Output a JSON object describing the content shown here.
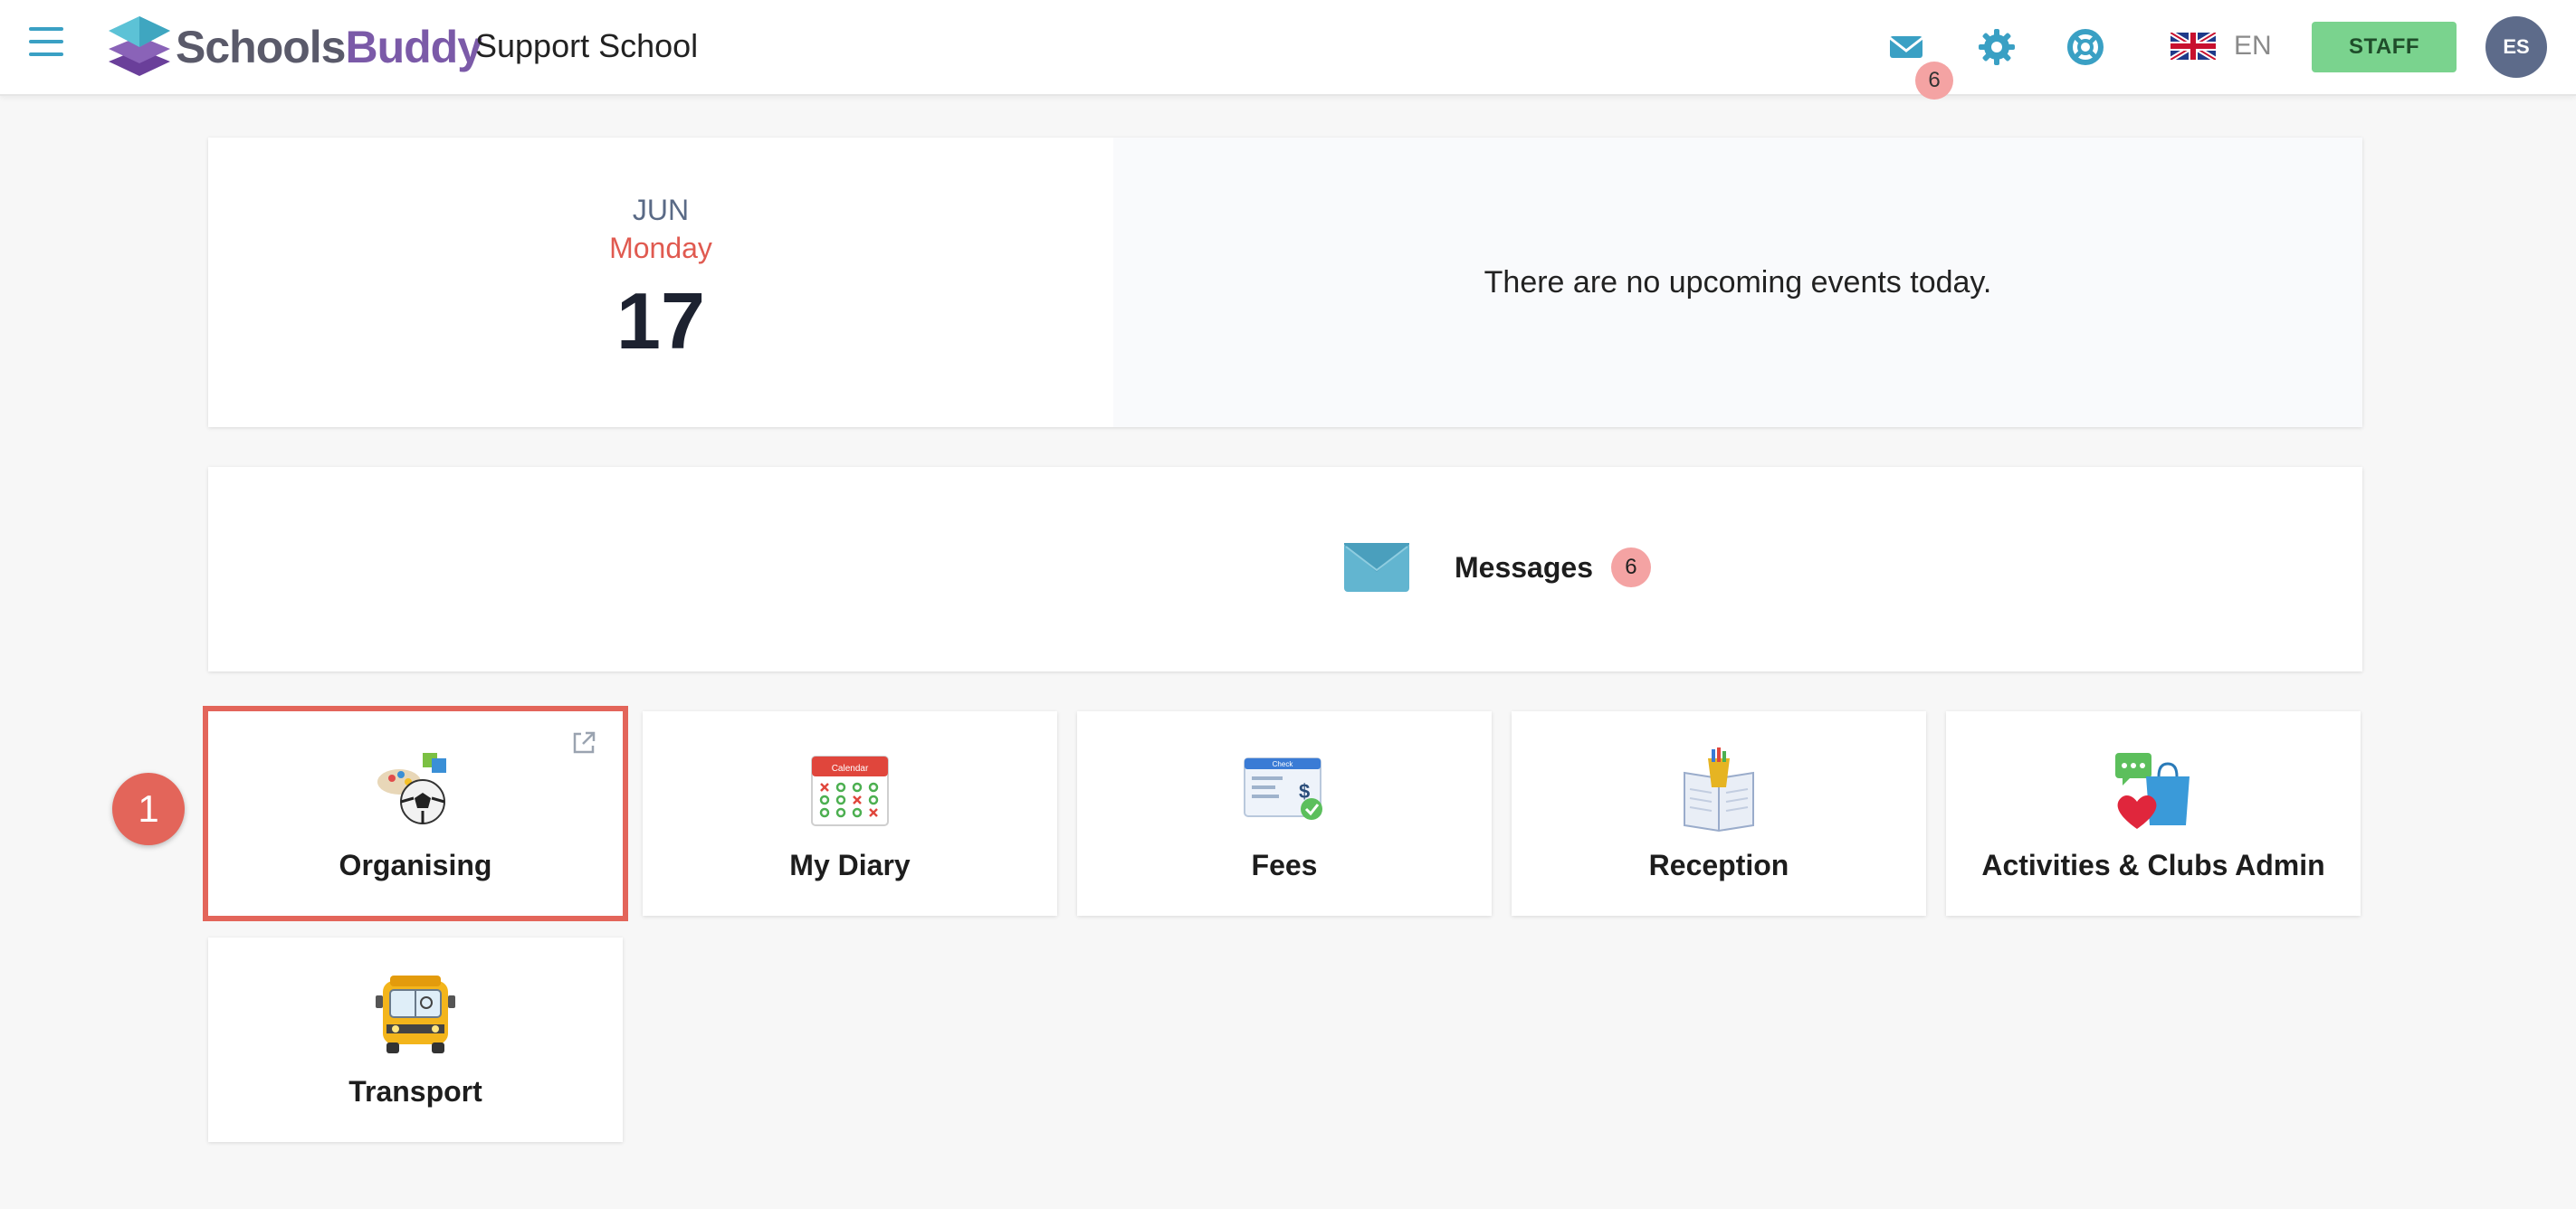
{
  "header": {
    "brand_part1": "Schools",
    "brand_part2": "Buddy",
    "school_name": "Support School",
    "mail_badge": "6",
    "language_code": "EN",
    "staff_label": "STAFF",
    "avatar_initials": "ES",
    "icons": [
      "menu-icon",
      "mail-icon",
      "gear-icon",
      "lifebuoy-icon",
      "uk-flag-icon"
    ]
  },
  "date_card": {
    "month": "JUN",
    "weekday": "Monday",
    "day": "17",
    "events_text": "There are no upcoming events today."
  },
  "messages_card": {
    "label": "Messages",
    "count": "6"
  },
  "tiles": [
    {
      "label": "Organising",
      "icon": "organising-icon",
      "selected": true
    },
    {
      "label": "My Diary",
      "icon": "calendar-icon"
    },
    {
      "label": "Fees",
      "icon": "fees-check-icon"
    },
    {
      "label": "Reception",
      "icon": "reception-book-icon"
    },
    {
      "label": "Activities & Clubs Admin",
      "icon": "activities-icon"
    },
    {
      "label": "Transport",
      "icon": "school-bus-icon"
    }
  ],
  "annotation": {
    "step_number": "1"
  },
  "colors": {
    "accent": "#3aa0c4",
    "brand_purple": "#7b5aa8",
    "badge": "#f4a3a3",
    "staff_button": "#7ad38e",
    "highlight": "#e3655a"
  }
}
